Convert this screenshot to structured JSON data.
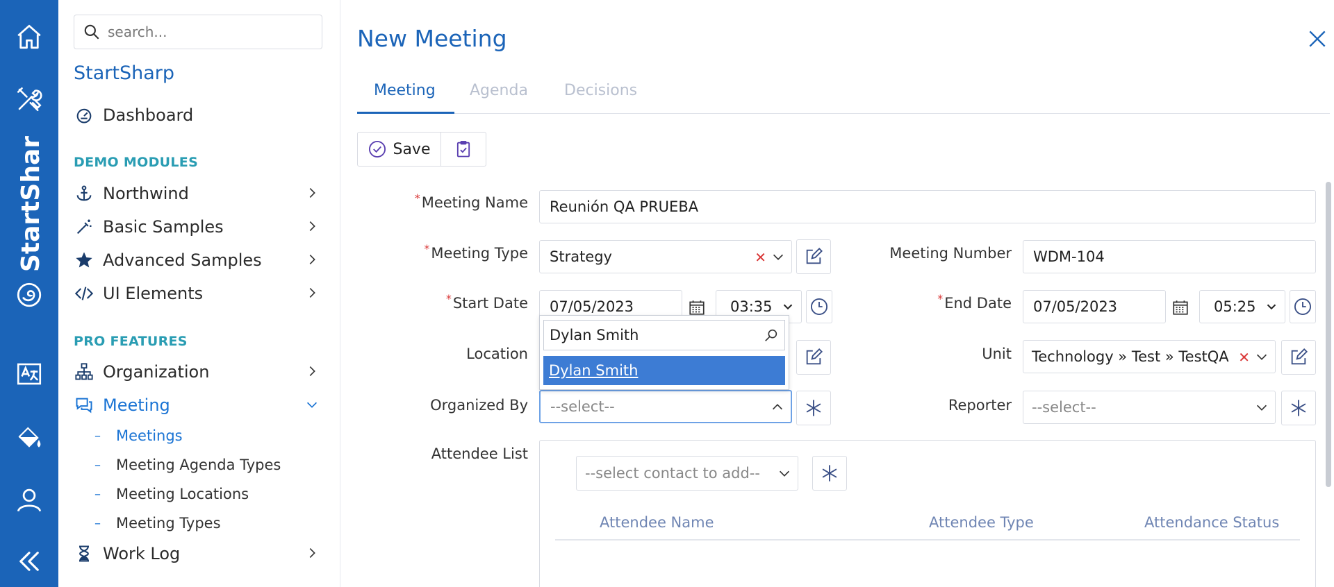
{
  "rail": {
    "brand_text": "StartShar",
    "icons": [
      "home-icon",
      "tools-icon",
      "logo-icon",
      "translate-icon",
      "paint-bucket-icon",
      "user-icon",
      "collapse-icon"
    ]
  },
  "sidebar": {
    "search_placeholder": "search...",
    "brand": "StartSharp",
    "dashboard": "Dashboard",
    "demo_title": "DEMO MODULES",
    "demo_items": [
      "Northwind",
      "Basic Samples",
      "Advanced Samples",
      "UI Elements"
    ],
    "pro_title": "PRO FEATURES",
    "organization": "Organization",
    "meeting": "Meeting",
    "meeting_sub": [
      "Meetings",
      "Meeting Agenda Types",
      "Meeting Locations",
      "Meeting Types"
    ],
    "work_log": "Work Log"
  },
  "dialog": {
    "title": "New Meeting",
    "tabs": [
      "Meeting",
      "Agenda",
      "Decisions"
    ],
    "save_label": "Save"
  },
  "form": {
    "meeting_name_label": "Meeting Name",
    "meeting_name_value": "Reunión QA PRUEBA",
    "meeting_type_label": "Meeting Type",
    "meeting_type_value": "Strategy",
    "meeting_number_label": "Meeting Number",
    "meeting_number_value": "WDM-104",
    "start_date_label": "Start Date",
    "start_date_value": "07/05/2023",
    "start_time_value": "03:35",
    "end_date_label": "End Date",
    "end_date_value": "07/05/2023",
    "end_time_value": "05:25",
    "location_label": "Location",
    "unit_label": "Unit",
    "unit_value": "Technology » Test » TestQA",
    "organized_by_label": "Organized By",
    "organized_by_placeholder": "--select--",
    "reporter_label": "Reporter",
    "reporter_placeholder": "--select--",
    "attendee_list_label": "Attendee List",
    "attendee_select_placeholder": "--select contact to add--",
    "attendee_columns": [
      "Attendee Name",
      "Attendee Type",
      "Attendance Status"
    ]
  },
  "dropdown": {
    "search_value": "Dylan Smith",
    "option": "Dylan Smith"
  },
  "colors": {
    "rail": "#1b64b8",
    "accent": "#1b64b8",
    "section": "#2a9db3",
    "highlight": "#3d7cd4",
    "required": "#d93636"
  }
}
